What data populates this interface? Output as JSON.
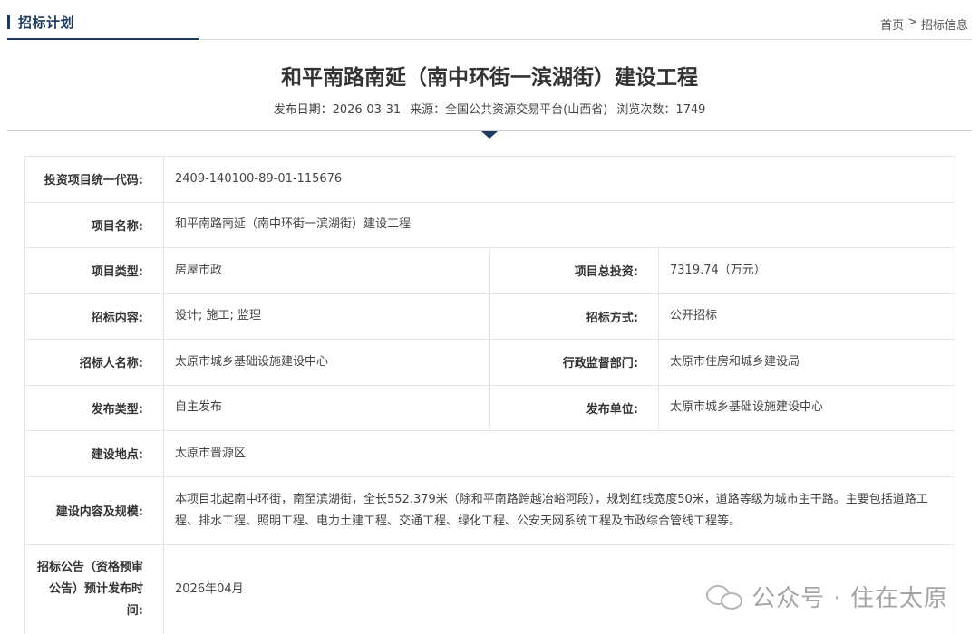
{
  "header": {
    "section_title": "招标计划",
    "breadcrumb": {
      "home": "首页",
      "separator": ">",
      "current": "招标信息"
    }
  },
  "article": {
    "title": "和平南路南延（南中环街一滨湖街）建设工程",
    "meta": {
      "publish_date": "发布日期：2026-03-31",
      "source": "来源：全国公共资源交易平台(山西省)",
      "views": "浏览次数：1749"
    }
  },
  "details": {
    "code_label": "投资项目统一代码:",
    "code_value": "2409-140100-89-01-115676",
    "name_label": "项目名称:",
    "name_value": "和平南路南延（南中环街一滨湖街）建设工程",
    "type_label": "项目类型:",
    "type_value": "房屋市政",
    "investment_label": "项目总投资:",
    "investment_value": "7319.74（万元）",
    "content_label": "招标内容:",
    "content_value": "设计; 施工; 监理",
    "method_label": "招标方式:",
    "method_value": "公开招标",
    "tenderer_label": "招标人名称:",
    "tenderer_value": "太原市城乡基础设施建设中心",
    "supervisor_label": "行政监督部门:",
    "supervisor_value": "太原市住房和城乡建设局",
    "publish_type_label": "发布类型:",
    "publish_type_value": "自主发布",
    "publisher_label": "发布单位:",
    "publisher_value": "太原市城乡基础设施建设中心",
    "location_label": "建设地点:",
    "location_value": "太原市晋源区",
    "scope_label": "建设内容及规模:",
    "scope_value": "本项目北起南中环街，南至滨湖街，全长552.379米（除和平南路跨越冶峪河段），规划红线宽度50米，道路等级为城市主干路。主要包括道路工程、排水工程、照明工程、电力土建工程、交通工程、绿化工程、公安天网系统工程及市政综合管线工程等。",
    "announce_label": "招标公告（资格预审公告）预计发布时间:",
    "announce_value": "2026年04月"
  },
  "watermark": {
    "text": "公众号 · 住在太原",
    "icon": "wechat-icon"
  },
  "colors": {
    "accent": "#1e3a5f",
    "border": "#e6e6e6",
    "text": "#333333"
  }
}
